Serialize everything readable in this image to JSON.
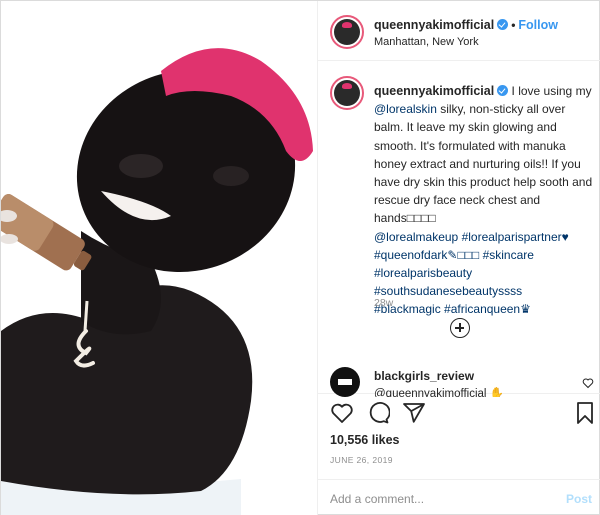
{
  "post": {
    "username": "queennyakimofficial",
    "follow_label": "Follow",
    "separator": "•",
    "location": "Manhattan, New York"
  },
  "caption": {
    "username": "queennyakimofficial",
    "line1": "I love using my ",
    "mention1": "@lorealskin",
    "line2": " silky, non-sticky all over balm. It leave my skin glowing and smooth. It's formulated with manuka honey extract and nurturing oils!! If you have dry skin this product help sooth and rescue dry face neck chest and hands",
    "emoji_run1": "□□□□",
    "mention2": "@lorealmakeup",
    "tag1": "#lorealparispartner",
    "heart": "♥",
    "tag2": "#queenofdark",
    "emoji_run2": "✎□□□",
    "tag3": "#skincare",
    "tag4": "#lorealparisbeauty",
    "tag5": "#southsudanesebeautyssss",
    "tag6": "#blackmagic",
    "tag7": "#africanqueen",
    "crown": "♛",
    "time": "28w"
  },
  "comment": {
    "username": "blackgirls_review",
    "text": "@queennyakimofficial ✋"
  },
  "likes": "10,556 likes",
  "date": "JUNE 26, 2019",
  "add_comment": {
    "placeholder": "Add a comment...",
    "post_label": "Post"
  },
  "icons": {
    "like": "heart-icon",
    "comment": "comment-icon",
    "share": "share-icon",
    "save": "bookmark-icon",
    "load_more": "plus-circle-icon"
  },
  "colors": {
    "link": "#003569",
    "follow": "#3897f0",
    "verified": "#3897f0",
    "hair": "#e0336e",
    "muted": "#8e8e8e"
  }
}
